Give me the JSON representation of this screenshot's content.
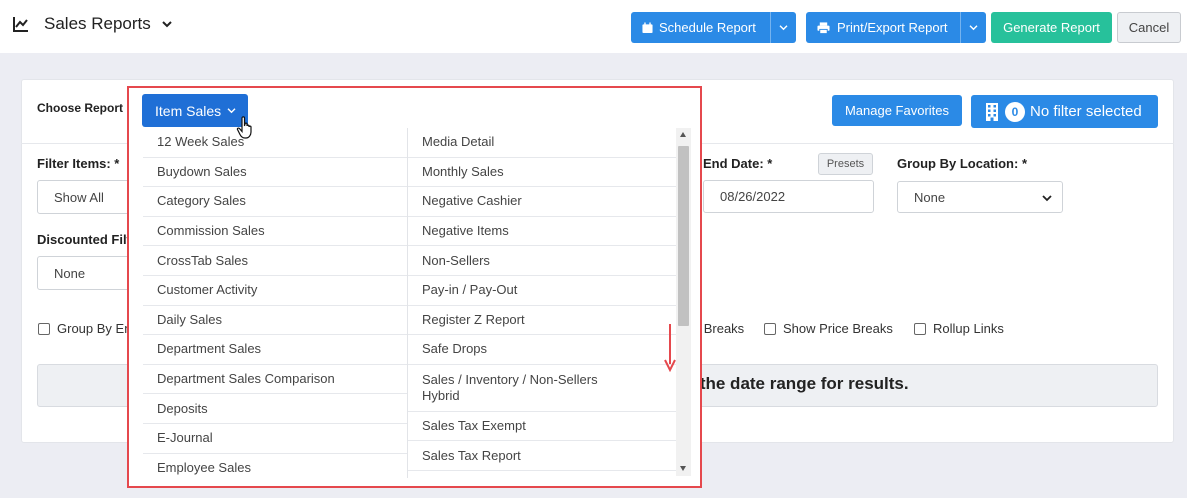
{
  "header": {
    "title": "Sales Reports",
    "buttons": {
      "schedule": "Schedule Report",
      "print_export": "Print/Export Report",
      "generate": "Generate Report",
      "cancel": "Cancel"
    }
  },
  "form": {
    "choose_report_label": "Choose Report",
    "selected_report": "Item Sales",
    "manage_favorites": "Manage Favorites",
    "filter": {
      "count": "0",
      "text": "No filter selected"
    },
    "filter_items_label": "Filter Items: *",
    "filter_items_value": "Show All",
    "end_date_label": "End Date: *",
    "presets_label": "Presets",
    "end_date_value": "08/26/2022",
    "group_by_location_label": "Group By Location: *",
    "group_by_location_value": "None",
    "discounted_filter_label": "Discounted Filte",
    "discounted_filter_value": "None",
    "checkboxes": {
      "group_by_emp": "Group By Emp",
      "cost_breaks": "st Breaks",
      "show_price_breaks": "Show Price Breaks",
      "rollup_links": "Rollup Links"
    },
    "message": "st the date range for results."
  },
  "dropdown": {
    "column1": [
      "12 Week Sales",
      "Buydown Sales",
      "Category Sales",
      "Commission Sales",
      "CrossTab Sales",
      "Customer Activity",
      "Daily Sales",
      "Department Sales",
      "Department Sales Comparison",
      "Deposits",
      "E-Journal",
      "Employee Sales"
    ],
    "column2": [
      "Media Detail",
      "Monthly Sales",
      "Negative Cashier",
      "Negative Items",
      "Non-Sellers",
      "Pay-in / Pay-Out",
      "Register Z Report",
      "Safe Drops",
      "Sales / Inventory / Non-Sellers Hybrid",
      "Sales Tax Exempt",
      "Sales Tax Report"
    ]
  },
  "colors": {
    "primary": "#2b8ae6",
    "generate": "#27c19b",
    "highlight": "#e5484d"
  }
}
